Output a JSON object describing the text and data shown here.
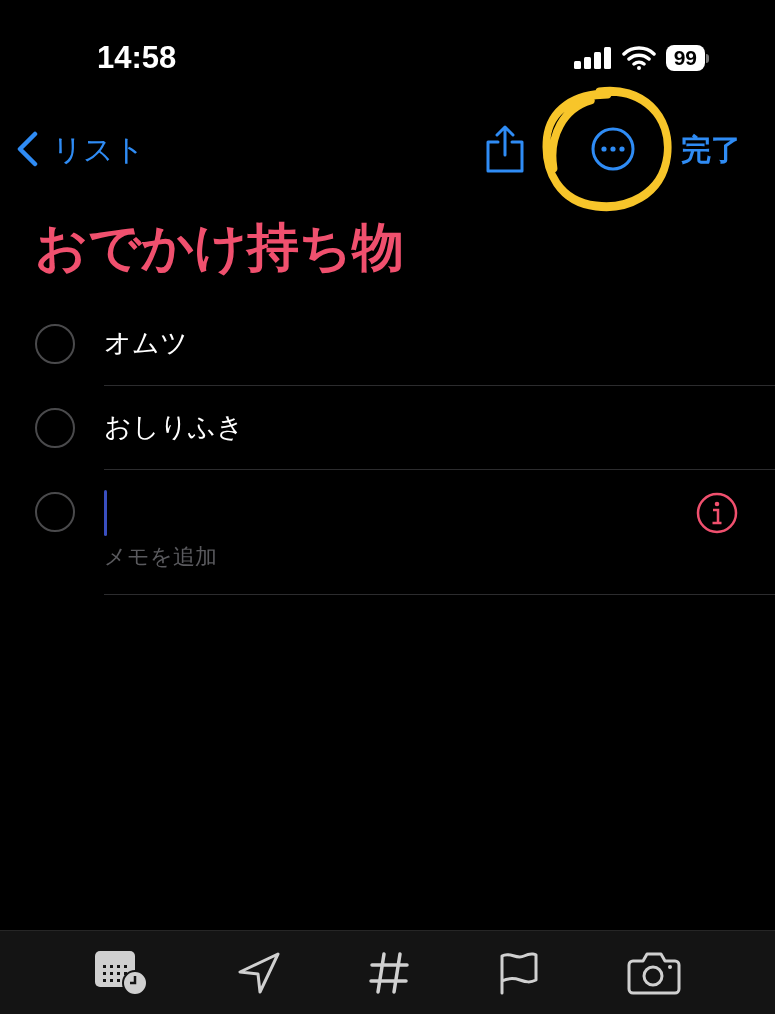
{
  "status_bar": {
    "time": "14:58",
    "battery": "99"
  },
  "nav": {
    "back": "リスト",
    "done": "完了"
  },
  "title": "おでかけ持ち物",
  "items": [
    {
      "kind": "item",
      "text": "オムツ",
      "checked": false
    },
    {
      "kind": "item",
      "text": "おしりふき",
      "checked": false
    },
    {
      "kind": "editing",
      "placeholder": "メモを追加",
      "checked": false
    }
  ]
}
